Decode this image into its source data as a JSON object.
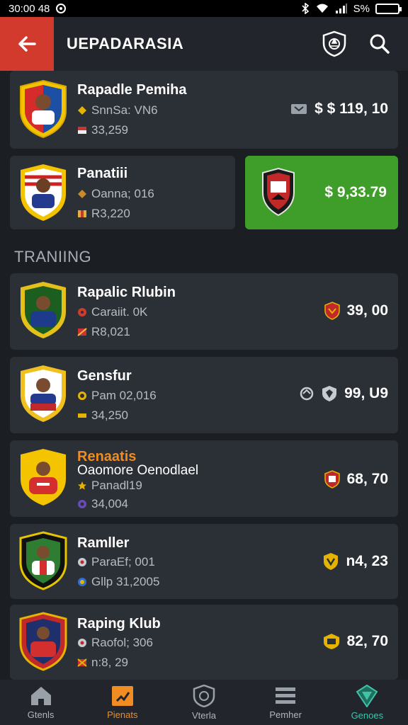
{
  "status_bar": {
    "time": "30:00 48",
    "battery": "S%"
  },
  "header": {
    "title": "UEPADARASIA"
  },
  "section": {
    "heading": "TRANIING"
  },
  "cards": [
    {
      "name": "Rapadle Pemiha",
      "line1": "SnnSa: VN6",
      "line2": "33,259",
      "price": "$ $ 119, 10"
    },
    {
      "name": "Panatiii",
      "line1": "Oanna; 016",
      "line2": "R3,220",
      "price": "$ 9,33.79"
    },
    {
      "name": "Rapalic Rlubin",
      "line1": "Caraiit. 0K",
      "line2": "R8,021",
      "price": "39, 00"
    },
    {
      "name": "Gensfur",
      "line1": "Pam 02,016",
      "line2": "34,250",
      "price": "99, U9"
    },
    {
      "name": "Renaatis",
      "subname": "Oaomore Oenodlael",
      "line1": "Panadl19",
      "line2": "34,004",
      "price": "68, 70"
    },
    {
      "name": "Ramller",
      "line1": "ParaEf; 001",
      "line2": "Gllp 31,2005",
      "price": "n4, 23"
    },
    {
      "name": "Raping Klub",
      "line1": "Raofol; 306",
      "line2": "n:8, 29",
      "price": "82, 70"
    }
  ],
  "nav": [
    {
      "label": "Gtenls"
    },
    {
      "label": "Pienats"
    },
    {
      "label": "Vterla"
    },
    {
      "label": "Pemher"
    },
    {
      "label": "Genoes"
    }
  ],
  "colors": {
    "accent_red": "#d23a2e",
    "accent_green": "#3f9e2a",
    "accent_orange": "#f08c22",
    "accent_teal": "#3fc4a8"
  }
}
